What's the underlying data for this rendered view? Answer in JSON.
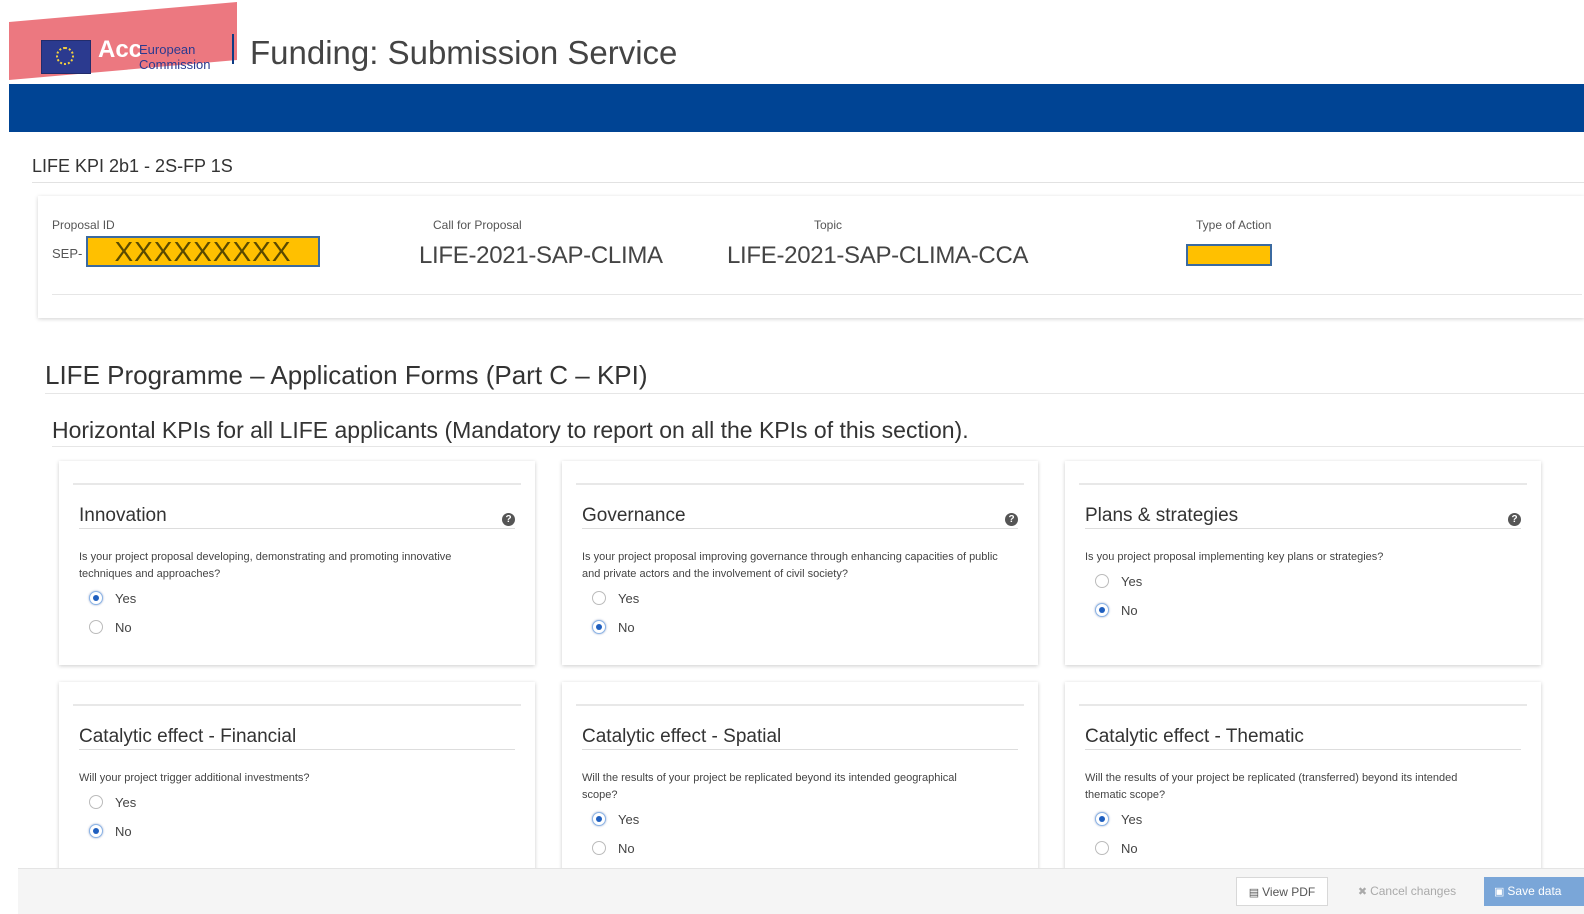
{
  "header": {
    "logo_overlay": "Acc",
    "logo_line1": "European",
    "logo_line2": "Commission",
    "service_title": "Funding: Submission Service"
  },
  "proposal": {
    "title": "LIFE KPI 2b1 - 2S-FP 1S",
    "id_label": "Proposal ID",
    "id_prefix": "SEP-",
    "id_value": "XXXXXXXXX",
    "call_label": "Call for Proposal",
    "call_value": "LIFE-2021-SAP-CLIMA",
    "topic_label": "Topic",
    "topic_value": "LIFE-2021-SAP-CLIMA-CCA",
    "action_label": "Type of Action",
    "redaction_color": "#ffc000"
  },
  "forms": {
    "heading": "LIFE Programme – Application Forms (Part C – KPI)",
    "section_heading": "Horizontal KPIs for all LIFE applicants (Mandatory to report on all the KPIs of this section).",
    "cards": [
      {
        "title": "Innovation",
        "question": "Is your project proposal developing, demonstrating and promoting innovative techniques and approaches?",
        "yes": "Yes",
        "no": "No",
        "selected": "yes"
      },
      {
        "title": "Governance",
        "question": "Is your project proposal improving governance through enhancing capacities of public and private actors and the involvement of civil society?",
        "yes": "Yes",
        "no": "No",
        "selected": "no"
      },
      {
        "title": "Plans & strategies",
        "question": "Is you project proposal implementing key plans or strategies?",
        "yes": "Yes",
        "no": "No",
        "selected": "no"
      },
      {
        "title": "Catalytic effect - Financial",
        "question": "Will your project trigger additional investments?",
        "yes": "Yes",
        "no": "No",
        "selected": "no"
      },
      {
        "title": "Catalytic effect - Spatial",
        "question": "Will the results of your project be replicated beyond its intended geographical scope?",
        "yes": "Yes",
        "no": "No",
        "selected": "yes"
      },
      {
        "title": "Catalytic effect - Thematic",
        "question": "Will the results of your project be replicated (transferred) beyond its intended thematic scope?",
        "yes": "Yes",
        "no": "No",
        "selected": "yes"
      }
    ]
  },
  "footer": {
    "view_pdf": "View PDF",
    "cancel": "Cancel changes",
    "save": "Save data"
  },
  "colors": {
    "brand_blue": "#004494",
    "radio_checked": "#1f5fbf"
  }
}
